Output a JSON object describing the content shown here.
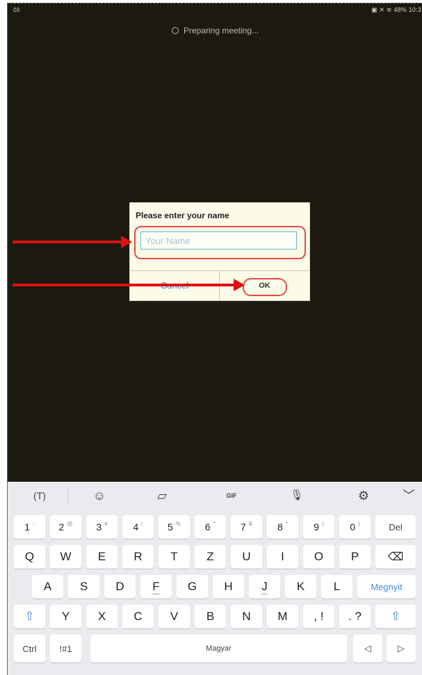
{
  "status_bar": {
    "left_icon": "notification-icon",
    "right_text": "48% 10:3"
  },
  "meeting": {
    "preparing_text": "Preparing meeting..."
  },
  "dialog": {
    "title": "Please enter your name",
    "name_placeholder": "Your Name",
    "name_value": "",
    "cancel_label": "Cancel",
    "ok_label": "OK"
  },
  "keyboard": {
    "toolbar": {
      "text_tool": "(T)",
      "emoji": "☺",
      "sticker": "▱",
      "gif": "GIF",
      "mic": "🎙",
      "settings": "⚙",
      "collapse": "﹀"
    },
    "row_numbers": [
      {
        "main": "1",
        "sup": "-"
      },
      {
        "main": "2",
        "sup": "@"
      },
      {
        "main": "3",
        "sup": "#"
      },
      {
        "main": "4",
        "sup": "/"
      },
      {
        "main": "5",
        "sup": "%"
      },
      {
        "main": "6",
        "sup": "^"
      },
      {
        "main": "7",
        "sup": "&"
      },
      {
        "main": "8",
        "sup": "*"
      },
      {
        "main": "9",
        "sup": "("
      },
      {
        "main": "0",
        "sup": ")"
      },
      {
        "main": "Del",
        "sup": ""
      }
    ],
    "row_q": [
      "Q",
      "W",
      "E",
      "R",
      "T",
      "Z",
      "U",
      "I",
      "O",
      "P",
      "⌫"
    ],
    "row_a": [
      "A",
      "S",
      "D",
      "F",
      "G",
      "H",
      "J",
      "K",
      "L",
      "Megnyit"
    ],
    "row_y": [
      "⇧",
      "Y",
      "X",
      "C",
      "V",
      "B",
      "N",
      "M",
      ", !",
      ". ?",
      "⇧"
    ],
    "row_bottom": {
      "ctrl": "Ctrl",
      "symbols": "!#1",
      "space": "Magyar",
      "left": "◁",
      "right": "▷"
    }
  }
}
